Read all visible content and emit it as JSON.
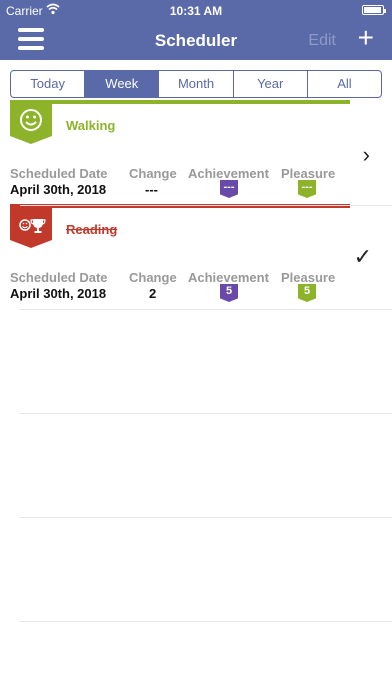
{
  "status": {
    "carrier": "Carrier",
    "time": "10:31 AM"
  },
  "nav": {
    "title": "Scheduler",
    "edit": "Edit",
    "add": "+"
  },
  "segments": [
    "Today",
    "Week",
    "Month",
    "Year",
    "All"
  ],
  "active_segment": "Week",
  "columns": {
    "date": "Scheduled Date",
    "change": "Change",
    "achievement": "Achievement",
    "pleasure": "Pleasure"
  },
  "activities": [
    {
      "name": "Walking",
      "date": "April 30th, 2018",
      "change": "---",
      "achievement": "---",
      "pleasure": "---",
      "color": "#8db32a",
      "status": "pending",
      "icon": "smiley-icon"
    },
    {
      "name": "Reading",
      "date": "April 30th, 2018",
      "change": "2",
      "achievement": "5",
      "pleasure": "5",
      "color": "#c0392b",
      "status": "done",
      "icon": "smiley-trophy-icon"
    }
  ],
  "colors": {
    "achievement": "#6a4aa8",
    "pleasure": "#8db32a",
    "brand": "#5a6aa8"
  }
}
